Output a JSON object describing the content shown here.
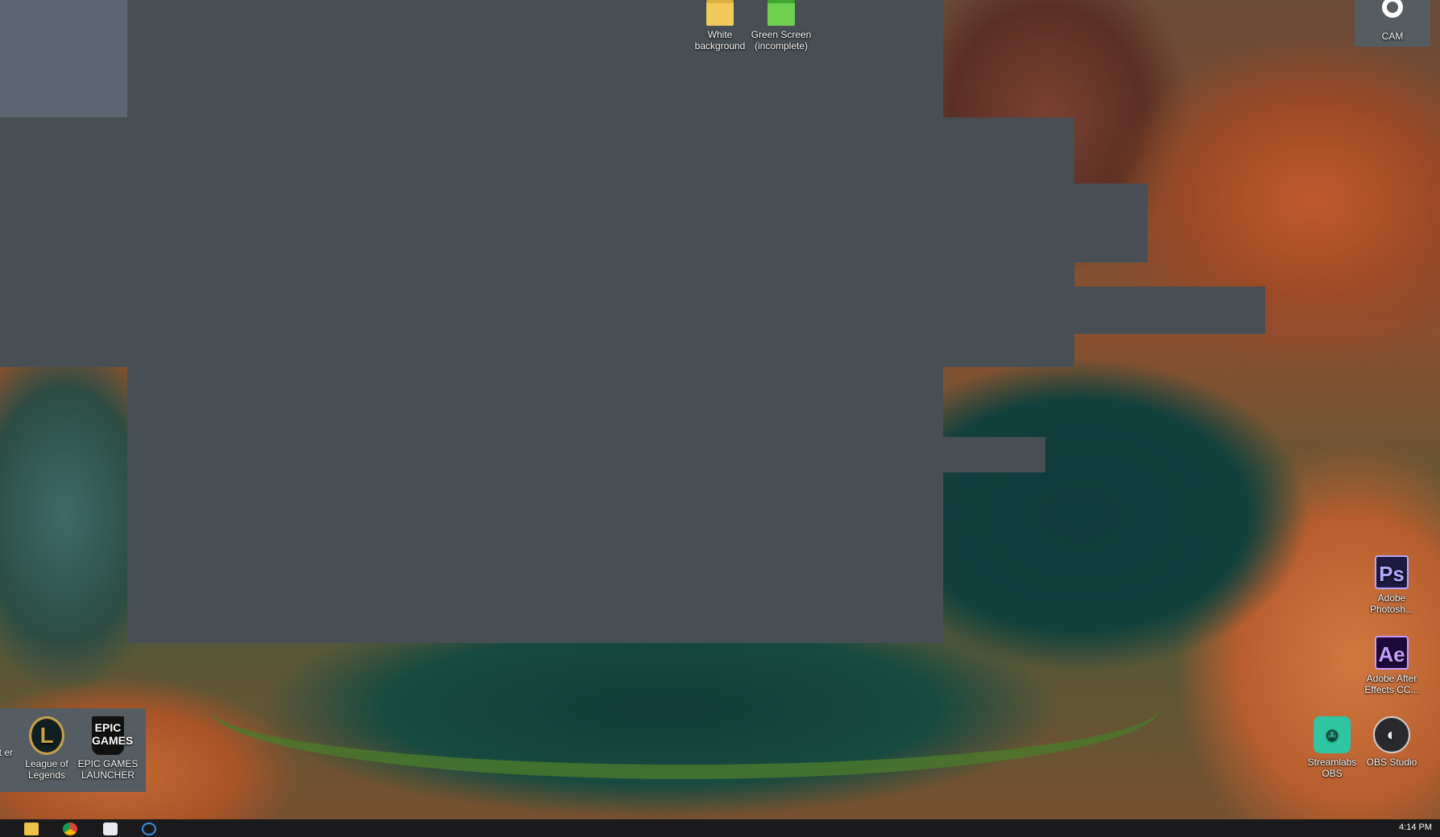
{
  "desktop": {
    "icons_top": [
      {
        "label": "White background",
        "icon": "folder-icon"
      },
      {
        "label": "Green Screen (incomplete)",
        "icon": "folder-green-icon"
      }
    ],
    "cam": {
      "label": "CAM",
      "icon": "camera-app-icon"
    },
    "icons_right": [
      {
        "label": "Adobe Photosh...",
        "icon": "photoshop-icon",
        "glyph": "Ps"
      },
      {
        "label": "Adobe After Effects CC...",
        "icon": "after-effects-icon",
        "glyph": "Ae"
      },
      {
        "label": "Streamlabs OBS",
        "icon": "streamlabs-icon",
        "glyph": "☺"
      },
      {
        "label": "OBS Studio",
        "icon": "obs-icon",
        "glyph": "◐"
      }
    ],
    "icons_bottom_left": [
      {
        "label": "et er",
        "icon": "cropped-app-icon"
      },
      {
        "label": "League of Legends",
        "icon": "league-icon",
        "glyph": "L"
      },
      {
        "label": "EPIC GAMES LAUNCHER",
        "icon": "epic-games-icon",
        "glyph": "EPIC GAMES"
      }
    ]
  },
  "taskbar": {
    "clock": "4:14 PM",
    "pinned": [
      "file-explorer-icon",
      "chrome-icon",
      "paint-icon",
      "network-icon"
    ]
  },
  "colors": {
    "window_block": "#474f55",
    "taskbar": "#1a1a1c"
  }
}
